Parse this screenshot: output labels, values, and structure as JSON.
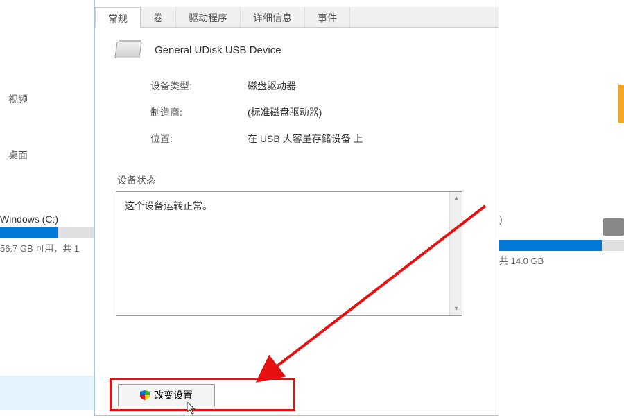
{
  "bg": {
    "sidebar": {
      "item_video": "视频",
      "item_desktop": "桌面"
    },
    "drive_c": {
      "name": "Windows (C:)",
      "text": "56.7 GB 可用，共 1"
    },
    "drive_right": {
      "paren": ")",
      "text": "共 14.0 GB"
    }
  },
  "dialog": {
    "tabs": {
      "general": "常规",
      "volumes": "卷",
      "driver": "驱动程序",
      "details": "详细信息",
      "events": "事件"
    },
    "device_name": "General UDisk USB Device",
    "info": {
      "type_label": "设备类型:",
      "type_value": "磁盘驱动器",
      "manufacturer_label": "制造商:",
      "manufacturer_value": "(标准磁盘驱动器)",
      "location_label": "位置:",
      "location_value": "在 USB 大容量存储设备 上"
    },
    "status": {
      "label": "设备状态",
      "text": "这个设备运转正常。"
    },
    "change_settings_btn": "改变设置"
  }
}
